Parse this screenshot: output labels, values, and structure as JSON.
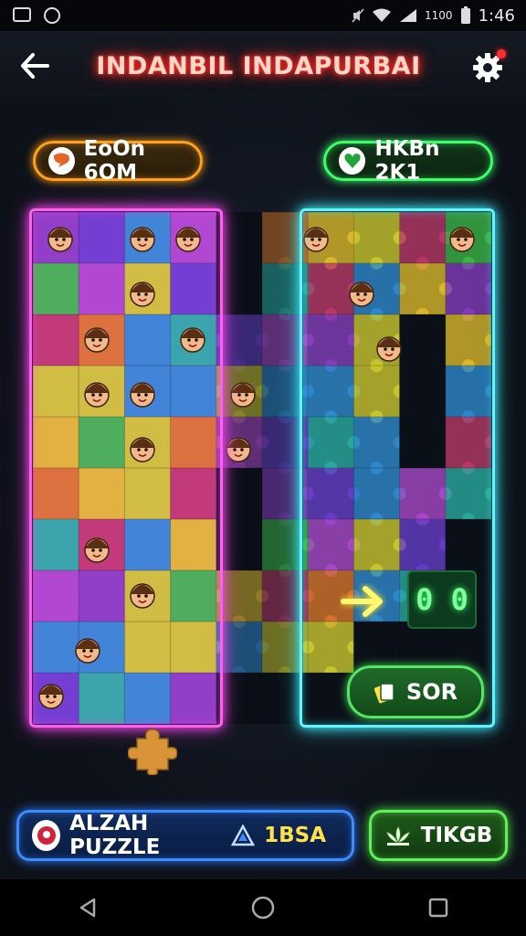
{
  "status_bar": {
    "time": "1:46",
    "extra_text": "1100"
  },
  "header": {
    "title": "INDANBIL INDAPURBAI"
  },
  "scores": {
    "left_label": "EoOn 6OM",
    "right_label": "HKBn 2K1"
  },
  "board": {
    "counter_value": "0 0",
    "sort_label": "SOR"
  },
  "bottom": {
    "puzzle_label": "ALZAH PUZZLE",
    "puzzle_right_label": "1BSA",
    "tikgb_label": "TIKGB"
  },
  "colors": {
    "left_glow": "#ff5ef5",
    "right_glow": "#5ff6ff",
    "title_glow": "#ff2a2a"
  }
}
